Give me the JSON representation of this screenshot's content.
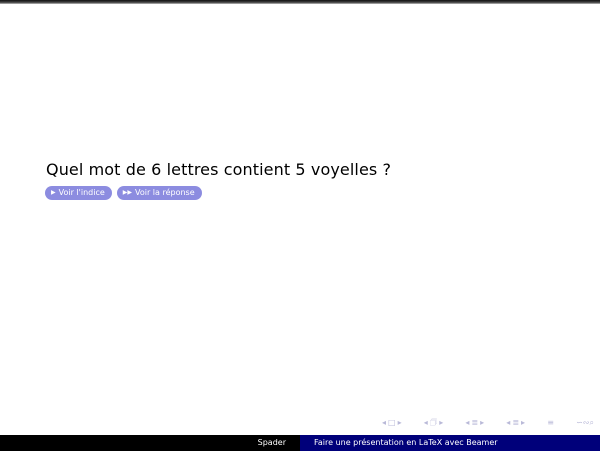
{
  "slide": {
    "question": "Quel mot de 6 lettres contient 5 voyelles ?",
    "buttons": {
      "hint": {
        "arrow": "▶",
        "label": "Voir l'indice"
      },
      "answer": {
        "arrow": "▶▶",
        "label": "Voir la réponse"
      }
    }
  },
  "navigation": {
    "frame_prev": "◂",
    "frame_icon": "□",
    "frame_next": "▸",
    "subsection_prev": "◂",
    "subsection_icon": "🗇",
    "subsection_next": "▸",
    "section_prev": "◂",
    "section_icon": "≣",
    "section_next": "▸",
    "doc_prev": "◂",
    "doc_icon": "≣",
    "doc_next": "▸",
    "appendix_icon": "≡",
    "search_icon": "∽∾⌕"
  },
  "footer": {
    "author": "Spader",
    "title": "Faire une présentation en LaTeX avec Beamer"
  },
  "colors": {
    "button_bg": "#8c8ce0",
    "footer_left_bg": "#000000",
    "footer_right_bg": "#00007a",
    "nav_symbols": "#b9b9d8"
  }
}
